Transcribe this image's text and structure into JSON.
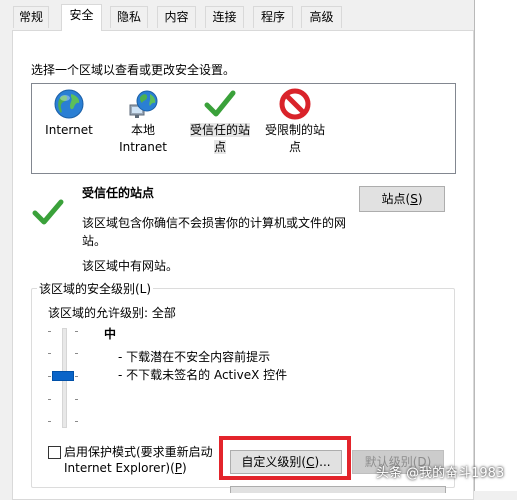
{
  "tabs": [
    {
      "label": "常规"
    },
    {
      "label": "安全",
      "active": true
    },
    {
      "label": "隐私"
    },
    {
      "label": "内容"
    },
    {
      "label": "连接"
    },
    {
      "label": "程序"
    },
    {
      "label": "高级"
    }
  ],
  "instruction": "选择一个区域以查看或更改安全设置。",
  "zones": [
    {
      "line1": "Internet",
      "line2": "",
      "icon": "globe-icon"
    },
    {
      "line1": "本地",
      "line2": "Intranet",
      "icon": "intranet-globe-icon"
    },
    {
      "line1": "受信任的站",
      "line2": "点",
      "icon": "checkmark-icon",
      "selected": true
    },
    {
      "line1": "受限制的站",
      "line2": "点",
      "icon": "prohibited-icon"
    }
  ],
  "selected_zone": {
    "title": "受信任的站点",
    "desc_line1": "该区域包含你确信不会损害你的计算机或文件的网",
    "desc_line2": "站。",
    "note": "该区域中有网站。"
  },
  "sites_button": {
    "label": "站点(",
    "key": "S",
    "suffix": ")"
  },
  "security_level": {
    "group_title": "该区域的安全级别(L)",
    "allowed": "该区域的允许级别: 全部",
    "level": "中",
    "bullet1": "- 下载潜在不安全内容前提示",
    "bullet2": "- 不下载未签名的 ActiveX 控件"
  },
  "protected_mode": {
    "line1": "启用保护模式(要求重新启动",
    "line2": "Internet Explorer)(",
    "key": "P",
    "suffix": ")",
    "checked": false
  },
  "custom_level_button": {
    "label": "自定义级别(",
    "key": "C",
    "suffix": ")..."
  },
  "default_level_button": {
    "label": "默认级别(D)"
  },
  "watermark": "头条 @我的奋斗1983",
  "colors": {
    "highlight_box": "#e3242b",
    "slider_thumb": "#0a64c8",
    "check_green": "#3aa13a",
    "prohibited_red": "#d9232a"
  }
}
